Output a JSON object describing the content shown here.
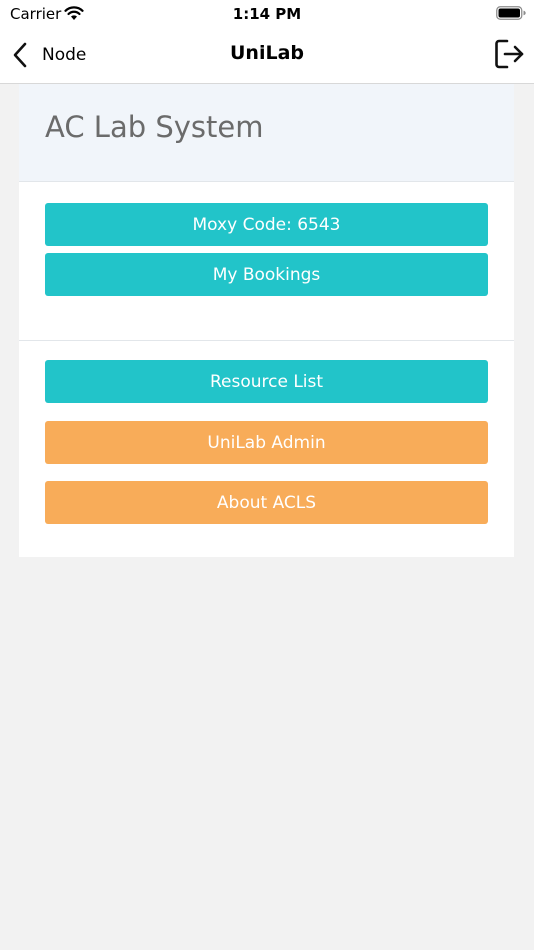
{
  "status_bar": {
    "carrier": "Carrier",
    "time": "1:14 PM"
  },
  "nav": {
    "back_label": "Node",
    "title": "UniLab"
  },
  "card": {
    "title": "AC Lab System"
  },
  "buttons": {
    "moxy_code": "Moxy Code: 6543",
    "my_bookings": "My Bookings",
    "resource_list": "Resource List",
    "unilab_admin": "UniLab Admin",
    "about_acls": "About ACLS"
  },
  "colors": {
    "teal": "#22c4c9",
    "orange": "#f8ac59",
    "header_bg": "#f1f5fa",
    "page_bg": "#f2f2f2"
  },
  "icons": {
    "back": "chevron-left-icon",
    "logout": "logout-icon",
    "wifi": "wifi-icon",
    "battery": "battery-icon"
  }
}
